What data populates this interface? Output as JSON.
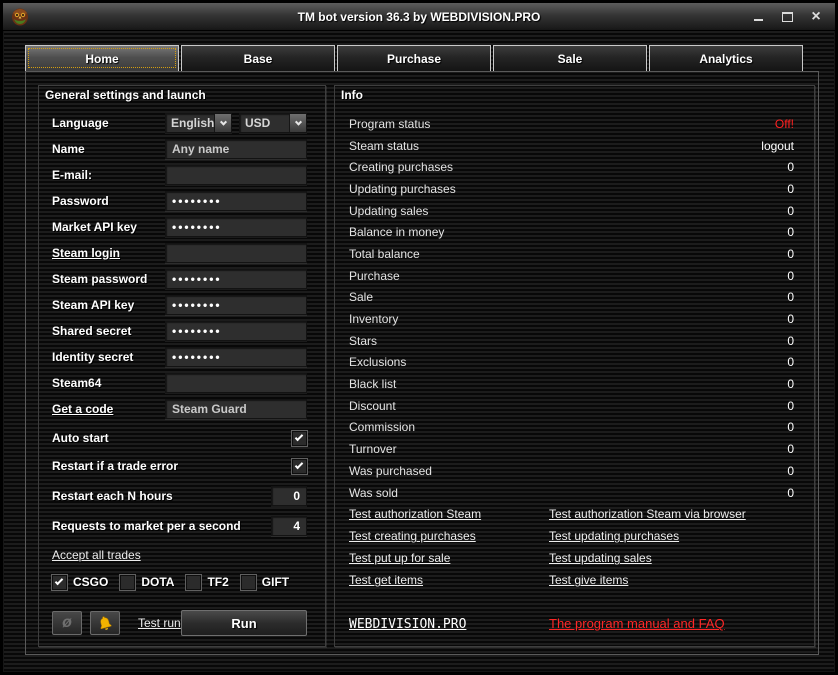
{
  "window": {
    "title": "TM bot version 36.3 by WEBDIVISION.PRO"
  },
  "tabs": [
    {
      "label": "Home",
      "active": true
    },
    {
      "label": "Base",
      "active": false
    },
    {
      "label": "Purchase",
      "active": false
    },
    {
      "label": "Sale",
      "active": false
    },
    {
      "label": "Analytics",
      "active": false
    }
  ],
  "settings": {
    "title": "General settings and launch",
    "language": {
      "label": "Language",
      "value": "English",
      "currency": "USD"
    },
    "name": {
      "label": "Name",
      "value": "Any name"
    },
    "email": {
      "label": "E-mail:",
      "value": ""
    },
    "password": {
      "label": "Password",
      "masked": "••••••••"
    },
    "market_api_key": {
      "label": "Market API key",
      "masked": "••••••••"
    },
    "steam_login": {
      "label": "Steam login",
      "value": ""
    },
    "steam_password": {
      "label": "Steam password",
      "masked": "••••••••"
    },
    "steam_api_key": {
      "label": "Steam API key",
      "masked": "••••••••"
    },
    "shared_secret": {
      "label": "Shared secret",
      "masked": "••••••••"
    },
    "identity_secret": {
      "label": "Identity secret",
      "masked": "••••••••"
    },
    "steam64": {
      "label": "Steam64",
      "value": ""
    },
    "get_a_code": {
      "label": "Get a code",
      "value": "Steam Guard"
    },
    "auto_start": {
      "label": "Auto start",
      "checked": true
    },
    "restart_trade_error": {
      "label": "Restart if a trade error",
      "checked": true
    },
    "restart_hours": {
      "label": "Restart each N hours",
      "value": "0"
    },
    "requests_per_second": {
      "label": "Requests to market per a second",
      "value": "4"
    },
    "accept_all_trades": "Accept all trades",
    "games": [
      {
        "label": "CSGO",
        "checked": true
      },
      {
        "label": "DOTA",
        "checked": false
      },
      {
        "label": "TF2",
        "checked": false
      },
      {
        "label": "GIFT",
        "checked": false
      }
    ],
    "test_run": "Test run",
    "run": "Run"
  },
  "info": {
    "title": "Info",
    "rows": [
      {
        "label": "Program status",
        "value": "Off!",
        "color": "#ff2121"
      },
      {
        "label": "Steam status",
        "value": "logout"
      },
      {
        "label": "Creating purchases",
        "value": "0"
      },
      {
        "label": "Updating purchases",
        "value": "0"
      },
      {
        "label": "Updating sales",
        "value": "0"
      },
      {
        "label": "Balance in money",
        "value": "0"
      },
      {
        "label": "Total balance",
        "value": "0"
      },
      {
        "label": "Purchase",
        "value": "0"
      },
      {
        "label": "Sale",
        "value": "0"
      },
      {
        "label": "Inventory",
        "value": "0"
      },
      {
        "label": "Stars",
        "value": "0"
      },
      {
        "label": "Exclusions",
        "value": "0"
      },
      {
        "label": "Black list",
        "value": "0"
      },
      {
        "label": "Discount",
        "value": "0"
      },
      {
        "label": "Commission",
        "value": "0"
      },
      {
        "label": "Turnover",
        "value": "0"
      },
      {
        "label": "Was purchased",
        "value": "0"
      },
      {
        "label": "Was sold",
        "value": "0"
      }
    ],
    "test_links": [
      {
        "left": "Test authorization Steam",
        "right": "Test authorization Steam via browser"
      },
      {
        "left": "Test creating purchases",
        "right": "Test updating purchases"
      },
      {
        "left": "Test put up for sale",
        "right": "Test updating sales"
      },
      {
        "left": "Test get items",
        "right": "Test give items"
      }
    ],
    "footer_left": "WEBDIVISION.PRO",
    "footer_right": "The program manual and FAQ"
  },
  "colors": {
    "status_off": "#ff2121",
    "manual_link": "#ff2727",
    "focus_outline": "#d59e10"
  }
}
